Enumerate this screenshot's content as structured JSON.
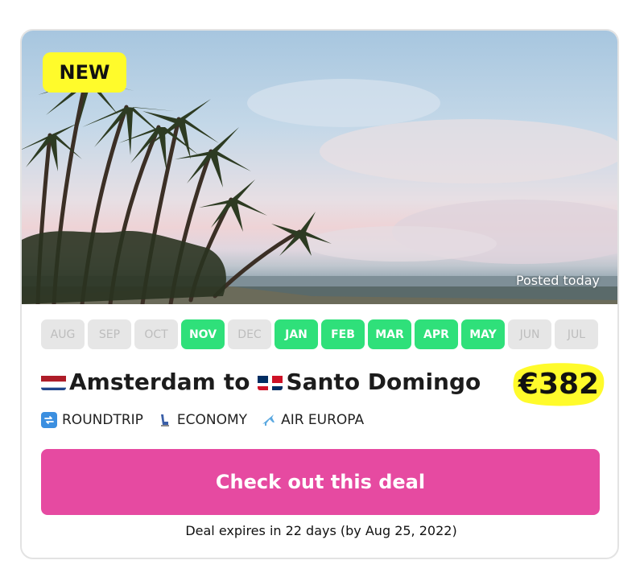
{
  "badge": {
    "label": "NEW",
    "color": "#fffb2b"
  },
  "hero": {
    "posted": "Posted today",
    "image": "tropical-beach-palm-trees-photo"
  },
  "months": [
    {
      "label": "AUG",
      "available": false
    },
    {
      "label": "SEP",
      "available": false
    },
    {
      "label": "OCT",
      "available": false
    },
    {
      "label": "NOV",
      "available": true
    },
    {
      "label": "DEC",
      "available": false
    },
    {
      "label": "JAN",
      "available": true
    },
    {
      "label": "FEB",
      "available": true
    },
    {
      "label": "MAR",
      "available": true
    },
    {
      "label": "APR",
      "available": true
    },
    {
      "label": "MAY",
      "available": true
    },
    {
      "label": "JUN",
      "available": false
    },
    {
      "label": "JUL",
      "available": false
    }
  ],
  "route": {
    "origin": "Amsterdam",
    "connector": "to",
    "destination": "Santo Domingo",
    "origin_flag": "netherlands-flag",
    "destination_flag": "dominican-republic-flag"
  },
  "price": {
    "value": "€382",
    "highlight": "#fffb2b"
  },
  "meta": [
    {
      "icon": "repeat-icon",
      "label": "ROUNDTRIP"
    },
    {
      "icon": "seat-icon",
      "label": "ECONOMY"
    },
    {
      "icon": "airplane-icon",
      "label": "AIR EUROPA"
    }
  ],
  "cta": {
    "label": "Check out this deal",
    "color": "#e64aa1"
  },
  "expires": "Deal expires in 22 days (by Aug 25, 2022)",
  "colors": {
    "month_on": "#2fe07a",
    "month_off": "#e6e6e6"
  }
}
